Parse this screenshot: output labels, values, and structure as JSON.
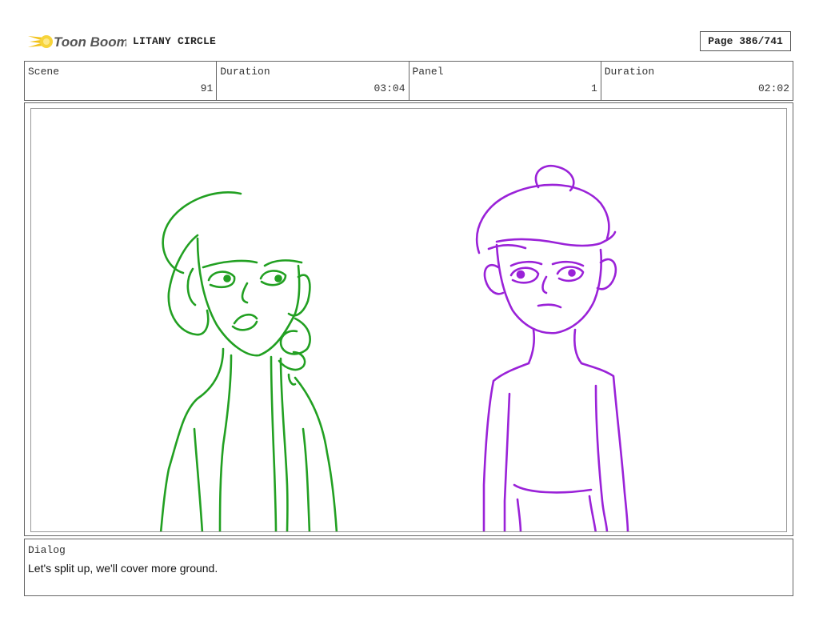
{
  "brand": {
    "logo_text": "Toon Boom",
    "accent_color": "#f2c21b",
    "text_color": "#555555"
  },
  "header": {
    "title": "LITANY CIRCLE",
    "page": "Page 386/741"
  },
  "info": [
    {
      "label": "Scene",
      "value": "91"
    },
    {
      "label": "Duration",
      "value": "03:04"
    },
    {
      "label": "Panel",
      "value": "1"
    },
    {
      "label": "Duration",
      "value": "02:02"
    }
  ],
  "dialog": {
    "label": "Dialog",
    "text": "Let's split up, we'll cover more ground."
  },
  "colors": {
    "left_character": "#22a022",
    "right_character": "#9a22d8"
  }
}
